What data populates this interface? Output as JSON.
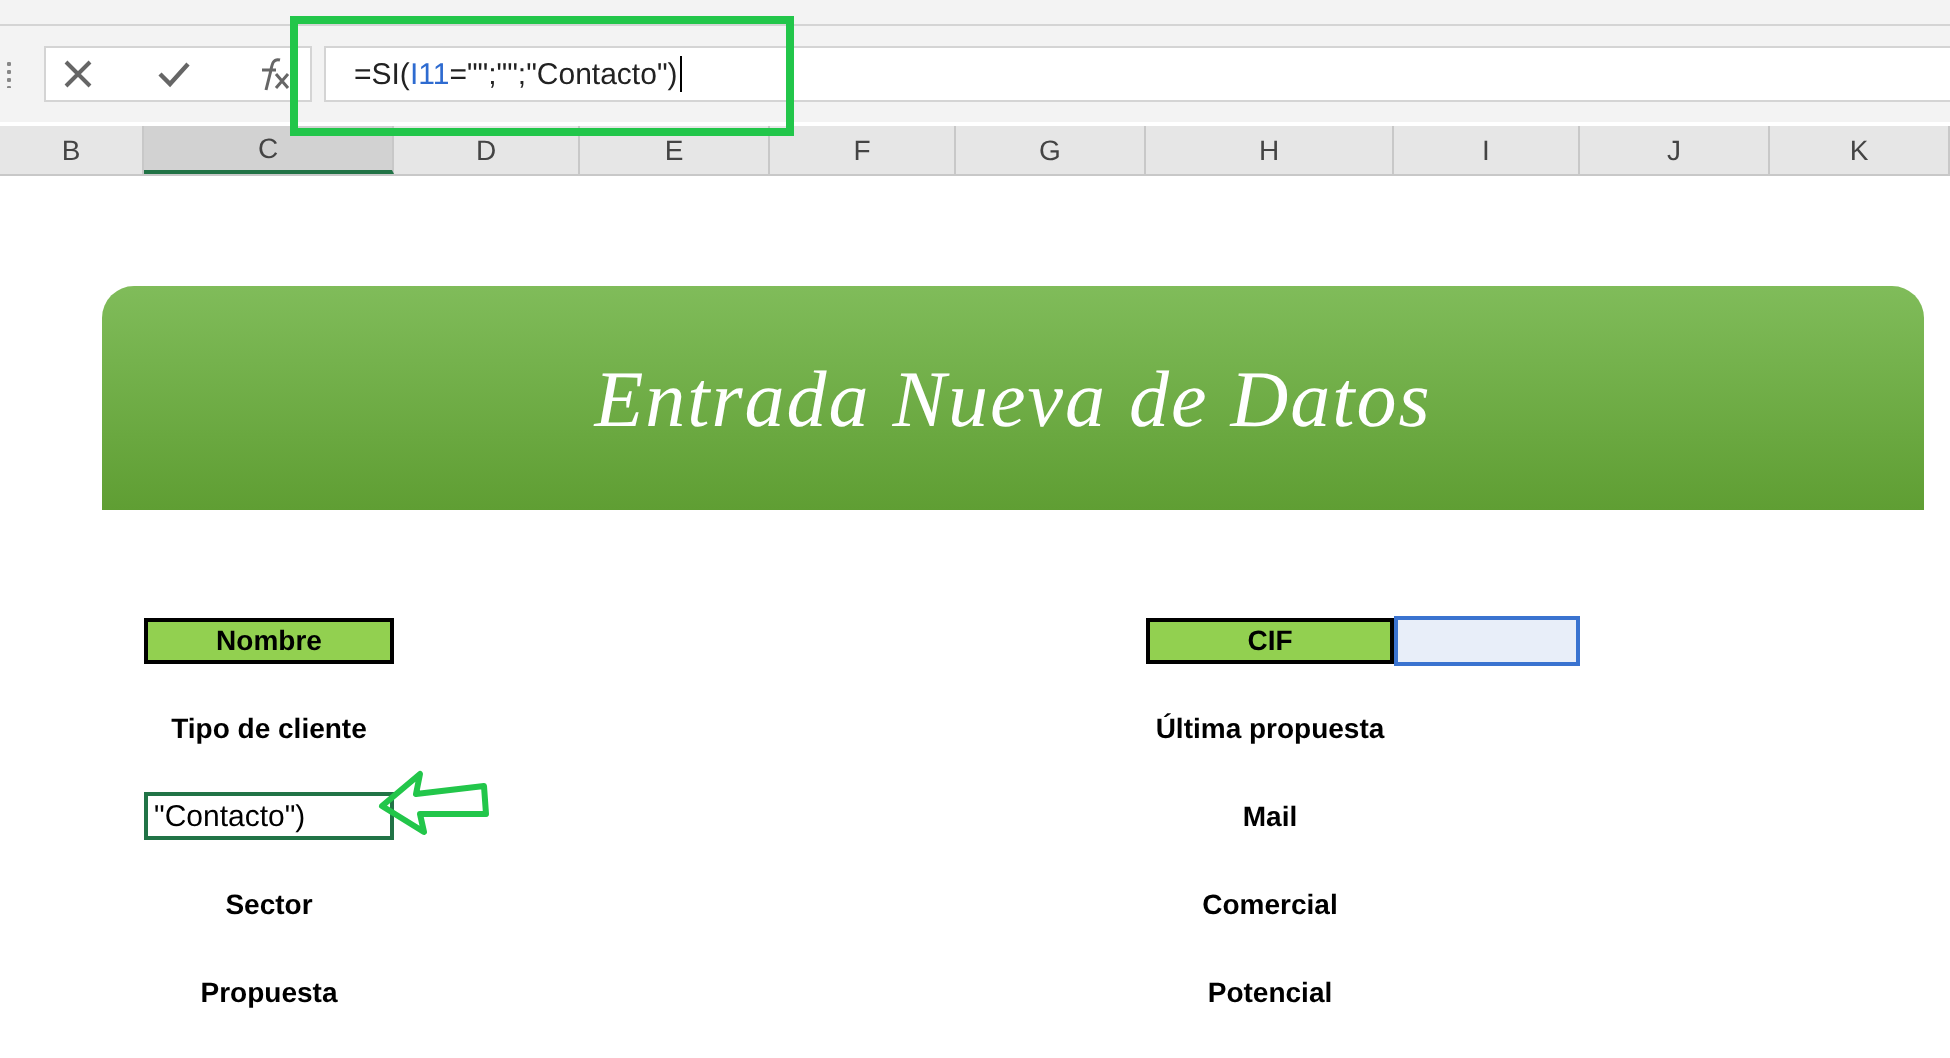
{
  "formula_bar": {
    "formula": [
      {
        "text": "=SI(",
        "kind": "plain"
      },
      {
        "text": "I11",
        "kind": "reference"
      },
      {
        "text": "=\"\";\"\";\"Contacto\")",
        "kind": "plain"
      }
    ]
  },
  "columns": [
    {
      "label": "B",
      "selected": false
    },
    {
      "label": "C",
      "selected": true
    },
    {
      "label": "D",
      "selected": false
    },
    {
      "label": "E",
      "selected": false
    },
    {
      "label": "F",
      "selected": false
    },
    {
      "label": "G",
      "selected": false
    },
    {
      "label": "H",
      "selected": false
    },
    {
      "label": "I",
      "selected": false
    },
    {
      "label": "J",
      "selected": false
    },
    {
      "label": "K",
      "selected": false
    }
  ],
  "banner": {
    "title": "Entrada Nueva de Datos"
  },
  "rows": [
    {
      "left": {
        "kind": "header",
        "text": "Nombre"
      },
      "right": {
        "kind": "header",
        "text": "CIF",
        "input_selected": true
      }
    },
    {
      "left": {
        "kind": "label",
        "text": "Tipo de cliente"
      },
      "right": {
        "kind": "label",
        "text": "Última propuesta"
      }
    },
    {
      "left": {
        "kind": "edit",
        "text": "\"Contacto\")"
      },
      "right": {
        "kind": "label",
        "text": "Mail"
      }
    },
    {
      "left": {
        "kind": "label",
        "text": "Sector"
      },
      "right": {
        "kind": "label",
        "text": "Comercial"
      }
    },
    {
      "left": {
        "kind": "label",
        "text": "Propuesta"
      },
      "right": {
        "kind": "label",
        "text": "Potencial"
      }
    }
  ]
}
